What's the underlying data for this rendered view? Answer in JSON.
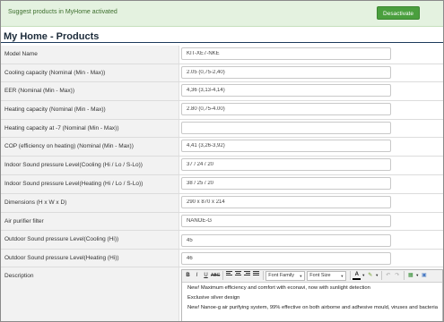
{
  "notice": {
    "message": "Suggest products in MyHome activated",
    "button_label": "Desactivate"
  },
  "page": {
    "title": "My Home - Products"
  },
  "fields": [
    {
      "label": "Model Name",
      "value": "KIT-XE7-NKE"
    },
    {
      "label": "Cooling capacity (Nominal (Min - Max))",
      "value": "2.05 (0,75-2,40)"
    },
    {
      "label": "EER (Nominal (Min - Max))",
      "value": "4,36 (3,13-4,14)"
    },
    {
      "label": "Heating capacity (Nominal (Min - Max))",
      "value": "2.80 (0,75-4.00)"
    },
    {
      "label": "Heating capacity at -7 (Nominal (Min - Max))",
      "value": ""
    },
    {
      "label": "COP (efficiency on heating) (Nominal (Min - Max))",
      "value": "4,41 (3,26-3,92)"
    },
    {
      "label": "Indoor Sound pressure Level(Cooling (Hi / Lo / S-Lo))",
      "value": "37 / 24 / 20"
    },
    {
      "label": "Indoor Sound pressure Level(Heating (Hi / Lo / S-Lo))",
      "value": "38 / 25 / 20"
    },
    {
      "label": "Dimensions (H x W x D)",
      "value": "290 x 870 x 214"
    },
    {
      "label": "Air purifier filter",
      "value": "NANOE-G"
    },
    {
      "label": "Outdoor Sound pressure Level(Cooling (Hi))",
      "value": "45"
    },
    {
      "label": "Outdoor Sound pressure Level(Heating (Hi))",
      "value": "46"
    }
  ],
  "description": {
    "label": "Description",
    "toolbar": {
      "bold": "B",
      "italic": "I",
      "underline": "U",
      "strike": "ABC",
      "font_family": "Font Family",
      "font_size": "Font Size",
      "text_color": "A"
    },
    "paragraphs": [
      "New! Maximum efficiency and comfort with econavi, now with sunlight detection",
      "Exclusive silver design",
      "New! Nanoe-g air purifying system, 99% effective on both airborne and adhesive mould, viruses and bacteria"
    ]
  },
  "colors": {
    "notice_bg": "#e4f2e0",
    "button_green": "#4a9f3e",
    "title_rule": "#1c3a5c"
  }
}
